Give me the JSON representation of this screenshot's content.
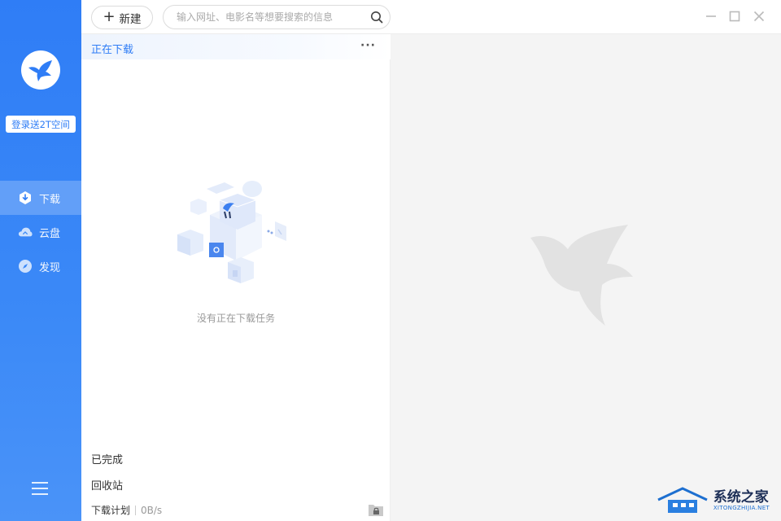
{
  "sidebar": {
    "login_button": "登录送2T空间",
    "items": [
      {
        "label": "下载",
        "icon": "download-icon",
        "active": true
      },
      {
        "label": "云盘",
        "icon": "cloud-icon",
        "active": false
      },
      {
        "label": "发现",
        "icon": "compass-icon",
        "active": false
      }
    ],
    "menu_icon": "hamburger-menu-icon"
  },
  "topbar": {
    "new_button": "新建",
    "search_placeholder": "输入网址、电影名等想要搜索的信息",
    "search_value": ""
  },
  "panel": {
    "header_title": "正在下载",
    "more_label": "···",
    "empty_text": "没有正在下载任务",
    "completed_label": "已完成",
    "recycle_label": "回收站",
    "plan_label": "下载计划",
    "speed": "0B/s"
  },
  "watermark": {
    "cn": "系统之家",
    "en": "XITONGZHIJIA.NET"
  },
  "colors": {
    "accent": "#2f7df6",
    "sidebar": "#3b89f7",
    "detail_bg": "#f4f4f4"
  }
}
